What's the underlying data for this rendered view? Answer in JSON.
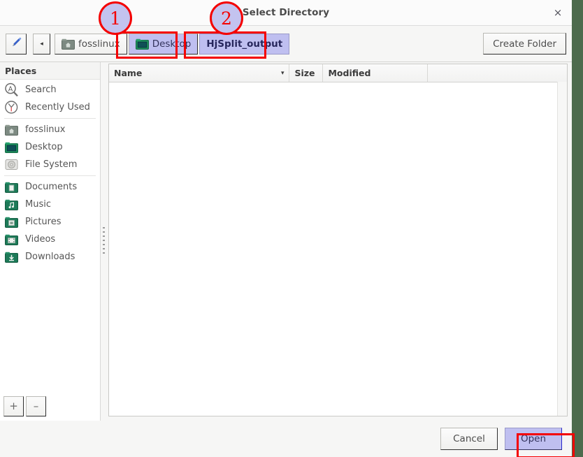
{
  "window": {
    "title": "Select Directory",
    "close_label": "×",
    "bg_outside": "#4d6b4d"
  },
  "toolbar": {
    "pencil_icon": "pencil-icon",
    "back_label": "◂",
    "crumbs": [
      {
        "label": "fosslinux",
        "icon": "home-folder-icon",
        "state": "normal"
      },
      {
        "label": "Desktop",
        "icon": "desktop-folder-icon",
        "state": "selected"
      },
      {
        "label": "HjSplit_output",
        "icon": "none",
        "state": "current"
      }
    ],
    "create_folder_label": "Create Folder"
  },
  "sidebar": {
    "header": "Places",
    "groups": [
      [
        {
          "label": "Search",
          "icon": "search-icon"
        },
        {
          "label": "Recently Used",
          "icon": "clock-icon"
        }
      ],
      [
        {
          "label": "fosslinux",
          "icon": "home-folder-icon"
        },
        {
          "label": "Desktop",
          "icon": "desktop-folder-icon"
        },
        {
          "label": "File System",
          "icon": "disk-icon"
        }
      ],
      [
        {
          "label": "Documents",
          "icon": "documents-folder-icon"
        },
        {
          "label": "Music",
          "icon": "music-folder-icon"
        },
        {
          "label": "Pictures",
          "icon": "pictures-folder-icon"
        },
        {
          "label": "Videos",
          "icon": "videos-folder-icon"
        },
        {
          "label": "Downloads",
          "icon": "downloads-folder-icon"
        }
      ]
    ],
    "add_label": "+",
    "remove_label": "–"
  },
  "file_pane": {
    "columns": [
      {
        "key": "name",
        "label": "Name",
        "sort": "descending",
        "sort_glyph": "▾"
      },
      {
        "key": "size",
        "label": "Size"
      },
      {
        "key": "modified",
        "label": "Modified"
      }
    ],
    "rows": [],
    "empty": true
  },
  "actions": {
    "cancel_label": "Cancel",
    "open_label": "Open"
  },
  "annotations": [
    {
      "id": "1",
      "label": "1",
      "target": "crumb-desktop"
    },
    {
      "id": "2",
      "label": "2",
      "target": "crumb-hjsplit-output"
    }
  ],
  "colors": {
    "highlight": "#bfbff0",
    "annotation": "#f40000",
    "accent_blue": "#2727cc",
    "desktop_bg": "#4d6b4d"
  }
}
